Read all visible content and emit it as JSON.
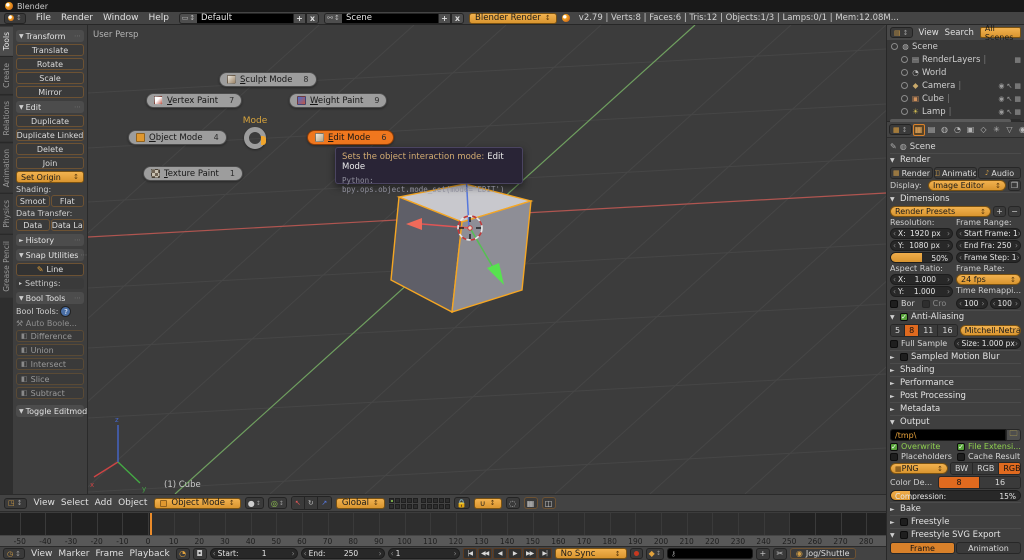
{
  "icons": {
    "check": "✓",
    "down": "▼",
    "right": "►",
    "updown": "↕"
  },
  "titlebar": {
    "title": "Blender"
  },
  "topbar": {
    "menus": [
      "File",
      "Render",
      "Window",
      "Help"
    ],
    "layout_field": {
      "value": "Default",
      "add": "+",
      "close": "x"
    },
    "scene_field": {
      "value": "Scene",
      "add": "+",
      "close": "x"
    },
    "engine": "Blender Render",
    "stats": "v2.79 | Verts:8 | Faces:6 | Tris:12 | Objects:1/3 | Lamps:0/1 | Mem:12.08M..."
  },
  "toolshelf": {
    "tabs": [
      "Tools",
      "Create",
      "Relations",
      "Animation",
      "Physics",
      "Grease Pencil"
    ],
    "active_tab": "Tools",
    "transform": {
      "title": "Transform",
      "buttons": [
        "Translate",
        "Rotate",
        "Scale",
        "Mirror"
      ]
    },
    "edit": {
      "title": "Edit",
      "buttons": [
        "Duplicate",
        "Duplicate Linked",
        "Delete",
        "Join"
      ],
      "set_origin": "Set Origin",
      "shading_label": "Shading:",
      "shading_buttons": [
        "Smoot",
        "Flat"
      ],
      "data_label": "Data Transfer:",
      "data_buttons": [
        "Data",
        "Data La"
      ]
    },
    "history_title": "History",
    "snap": {
      "title": "Snap Utilities",
      "line_button": "Line",
      "settings": "Settings:"
    },
    "bool": {
      "title": "Bool Tools",
      "label": "Bool Tools:",
      "auto": "Auto Boole...",
      "group1": [
        "Difference",
        "Union",
        "Intersect"
      ],
      "group2": [
        "Slice",
        "Subtract"
      ]
    },
    "toggle_title": "Toggle Editmode"
  },
  "viewport": {
    "view_label": "User Persp",
    "object_label": "(1) Cube",
    "gizmo": {
      "x": "x",
      "y": "y",
      "z": "z"
    },
    "pie": {
      "center_label": "Mode",
      "items": [
        {
          "label": "Sculpt Mode",
          "key": "8",
          "active": false
        },
        {
          "label": "Vertex Paint",
          "key": "7",
          "active": false
        },
        {
          "label": "Weight Paint",
          "key": "9",
          "active": false
        },
        {
          "label": "Object Mode",
          "key": "4",
          "active": false
        },
        {
          "label": "Edit Mode",
          "key": "6",
          "active": true
        },
        {
          "label": "Texture Paint",
          "key": "1",
          "active": false
        }
      ]
    },
    "tooltip": {
      "title": "Sets the object interaction mode:",
      "value": "Edit Mode",
      "python": "Python: bpy.ops.object.mode_set(mode='EDIT')"
    }
  },
  "outliner": {
    "menus": [
      "View",
      "Search"
    ],
    "scope": "All Scenes",
    "rows": [
      {
        "name": "Scene",
        "icon": "scene",
        "level": 0,
        "sep": false,
        "right": []
      },
      {
        "name": "RenderLayers",
        "icon": "render-layers",
        "level": 1,
        "sep": true,
        "right": [
          "render"
        ]
      },
      {
        "name": "World",
        "icon": "world",
        "level": 1,
        "sep": false,
        "right": []
      },
      {
        "name": "Camera",
        "icon": "camera",
        "level": 1,
        "sep": true,
        "right": [
          "eye",
          "select",
          "render"
        ]
      },
      {
        "name": "Cube",
        "icon": "mesh",
        "level": 1,
        "sep": true,
        "right": [
          "eye",
          "select",
          "render"
        ]
      },
      {
        "name": "Lamp",
        "icon": "lamp",
        "level": 1,
        "sep": true,
        "right": [
          "eye",
          "select",
          "render"
        ]
      }
    ]
  },
  "properties": {
    "tabs": [
      {
        "name": "render",
        "glyph": "▦",
        "active": true
      },
      {
        "name": "render-layers",
        "glyph": "▤",
        "active": false
      },
      {
        "name": "scene",
        "glyph": "◍",
        "active": false
      },
      {
        "name": "world",
        "glyph": "◔",
        "active": false
      },
      {
        "name": "object",
        "glyph": "▣",
        "active": false
      },
      {
        "name": "constraints",
        "glyph": "◇",
        "active": false
      },
      {
        "name": "modifiers",
        "glyph": "✳",
        "active": false
      },
      {
        "name": "data",
        "glyph": "▽",
        "active": false
      },
      {
        "name": "material",
        "glyph": "◉",
        "active": false
      },
      {
        "name": "texture",
        "glyph": "▩",
        "active": false
      }
    ],
    "breadcrumb": "Scene",
    "render": {
      "title": "Render",
      "buttons": [
        {
          "label": "Render",
          "icon": "camera"
        },
        {
          "label": "Animatio",
          "icon": "clapper"
        },
        {
          "label": "Audio",
          "icon": "speaker"
        }
      ],
      "display_label": "Display:",
      "display_value": "Image Editor"
    },
    "dimensions": {
      "title": "Dimensions",
      "presets": "Render Presets",
      "resolution_label": "Resolution:",
      "frame_range_label": "Frame Range:",
      "res_x": "X:",
      "res_x_val": "1920 px",
      "res_y": "Y:",
      "res_y_val": "1080 px",
      "res_pct": "50%",
      "start": "Start Frame: 1",
      "end": "End Fra: 250",
      "step": "Frame Step: 1",
      "aspect_label": "Aspect Ratio:",
      "frame_rate_label": "Frame Rate:",
      "asp_x": "X:",
      "asp_x_val": "1.000",
      "asp_y": "Y:",
      "asp_y_val": "1.000",
      "fps": "24 fps",
      "border": "Bor",
      "crop": "Cro",
      "remap_label": "Time Remappi...",
      "remap_a": "100",
      "remap_b": "100"
    },
    "aa": {
      "title": "Anti-Aliasing",
      "samples": [
        "5",
        "8",
        "11",
        "16"
      ],
      "active_sample": "8",
      "filter": "Mitchell-Netra...",
      "full_sample": "Full Sample",
      "size": "Size: 1.000 px"
    },
    "collapsed_mid": [
      {
        "label": "Sampled Motion Blur",
        "checkbox": true,
        "checked": false
      },
      {
        "label": "Shading",
        "checkbox": false
      },
      {
        "label": "Performance",
        "checkbox": false
      },
      {
        "label": "Post Processing",
        "checkbox": false
      },
      {
        "label": "Metadata",
        "checkbox": false
      }
    ],
    "output": {
      "title": "Output",
      "path": "/tmp\\",
      "checks": [
        {
          "label": "Overwrite",
          "checked": true
        },
        {
          "label": "File Extensi...",
          "checked": true
        },
        {
          "label": "Placeholders",
          "checked": false
        },
        {
          "label": "Cache Result",
          "checked": false
        }
      ],
      "format": "PNG",
      "channels": [
        "BW",
        "RGB",
        "RGBA"
      ],
      "active_channel": "RGBA",
      "depth_label": "Color De...",
      "depths": [
        "8",
        "16"
      ],
      "active_depth": "8",
      "compression_label": "Compression:",
      "compression_value": "15%"
    },
    "collapsed_bottom": [
      {
        "label": "Bake",
        "checkbox": false,
        "expanded": false
      },
      {
        "label": "Freestyle",
        "checkbox": true,
        "checked": false,
        "expanded": false
      },
      {
        "label": "Freestyle SVG Export",
        "checkbox": true,
        "checked": false,
        "expanded": true
      }
    ],
    "svg_export_buttons": [
      "Frame",
      "Animation"
    ],
    "svg_export_active": "Frame"
  },
  "view3d_header": {
    "menus": [
      "View",
      "Select",
      "Add",
      "Object"
    ],
    "mode": "Object Mode",
    "orientation": "Global"
  },
  "timeline": {
    "ticks": [
      -50,
      -40,
      -30,
      -20,
      -10,
      0,
      10,
      20,
      30,
      40,
      50,
      60,
      70,
      80,
      90,
      100,
      110,
      120,
      130,
      140,
      150,
      160,
      170,
      180,
      190,
      200,
      210,
      220,
      230,
      240,
      250,
      260,
      270,
      280
    ],
    "menus": [
      "View",
      "Marker",
      "Frame",
      "Playback"
    ],
    "start_label": "Start:",
    "start_value": "1",
    "end_label": "End:",
    "end_value": "250",
    "current_frame": "1",
    "playback_icons": [
      "|◀",
      "◀◀",
      "◀",
      "▶",
      "▶▶",
      "▶|"
    ],
    "sync": "No Sync",
    "jog": "Jog/Shuttle"
  }
}
